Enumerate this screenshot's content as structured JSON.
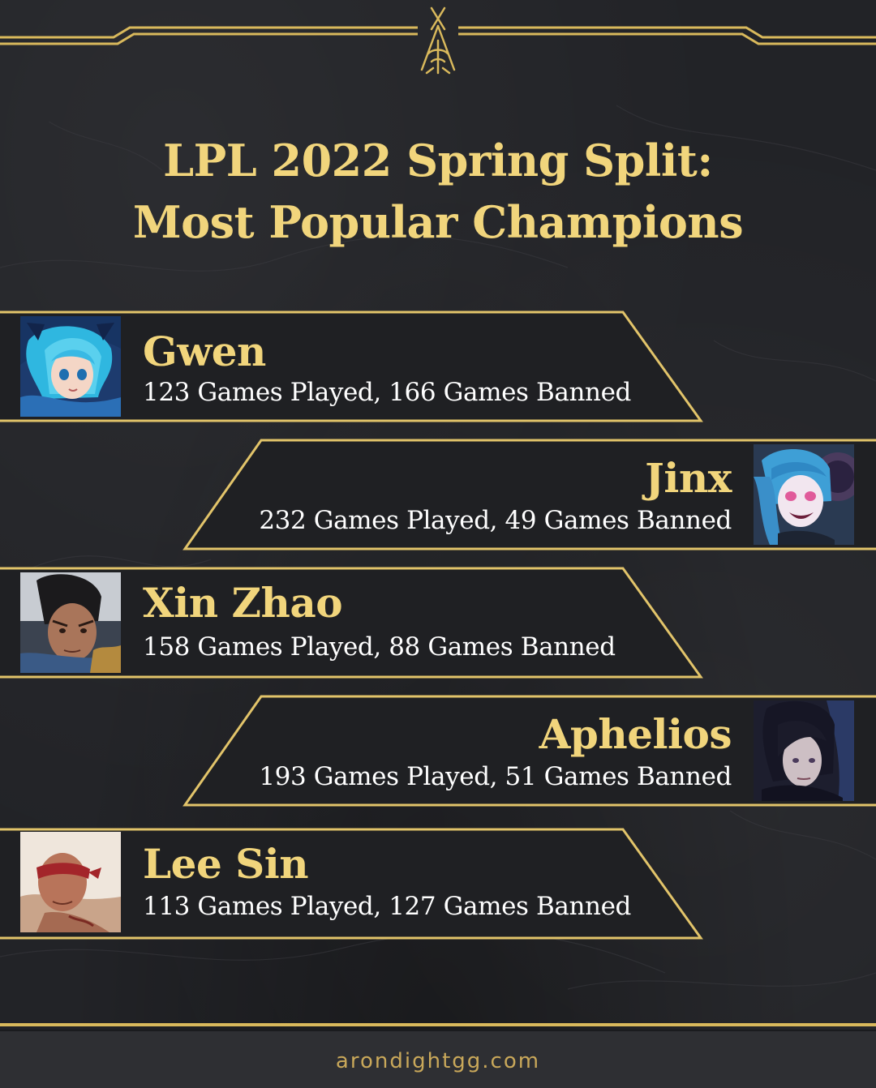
{
  "title": {
    "line1": "LPL 2022 Spring Split:",
    "line2": "Most Popular Champions"
  },
  "champions": [
    {
      "name": "Gwen",
      "stats": "123 Games Played, 166 Games Banned",
      "side": "left",
      "portrait": "gwen-portrait"
    },
    {
      "name": "Jinx",
      "stats": "232 Games Played, 49 Games Banned",
      "side": "right",
      "portrait": "jinx-portrait"
    },
    {
      "name": "Xin Zhao",
      "stats": "158 Games Played, 88 Games Banned",
      "side": "left",
      "portrait": "xin-zhao-portrait"
    },
    {
      "name": "Aphelios",
      "stats": "193 Games Played, 51 Games Banned",
      "side": "right",
      "portrait": "aphelios-portrait"
    },
    {
      "name": "Lee Sin",
      "stats": "113 Games Played, 127 Games Banned",
      "side": "left",
      "portrait": "lee-sin-portrait"
    }
  ],
  "footer": {
    "website": "arondightgg.com"
  },
  "colors": {
    "background": "#222327",
    "gold": "#f1d57c",
    "frame": "#d9b95c",
    "text": "#ffffff"
  },
  "icons": {
    "logo": "crossed-swords-emblem-icon"
  }
}
